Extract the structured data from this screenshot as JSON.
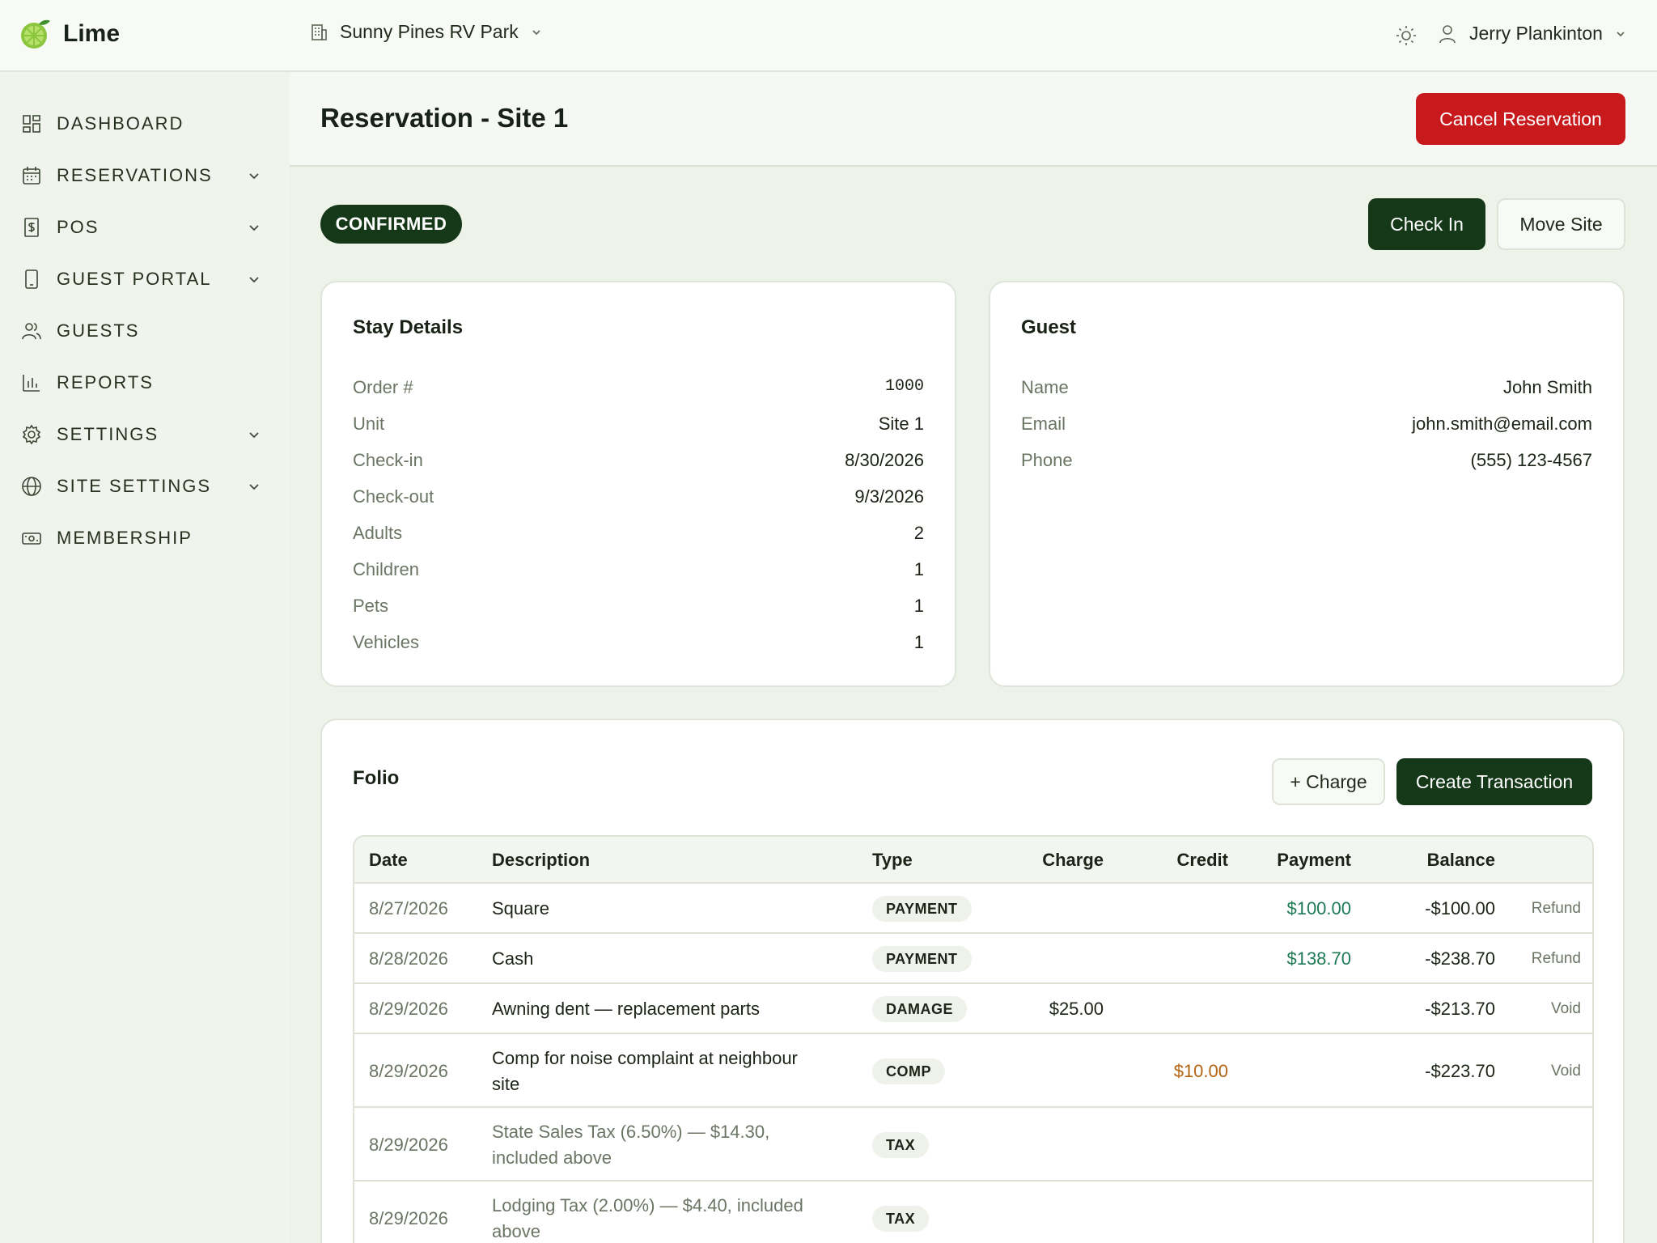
{
  "app": {
    "name": "Lime"
  },
  "topbar": {
    "park": "Sunny Pines RV Park",
    "user": "Jerry Plankinton"
  },
  "sidebar": {
    "items": [
      {
        "label": "DASHBOARD",
        "icon": "dashboard-icon",
        "expandable": false
      },
      {
        "label": "RESERVATIONS",
        "icon": "calendar-icon",
        "expandable": true
      },
      {
        "label": "POS",
        "icon": "receipt-icon",
        "expandable": true
      },
      {
        "label": "GUEST PORTAL",
        "icon": "tablet-icon",
        "expandable": true
      },
      {
        "label": "GUESTS",
        "icon": "users-icon",
        "expandable": false
      },
      {
        "label": "REPORTS",
        "icon": "bar-chart-icon",
        "expandable": false
      },
      {
        "label": "SETTINGS",
        "icon": "gear-icon",
        "expandable": true
      },
      {
        "label": "SITE SETTINGS",
        "icon": "globe-icon",
        "expandable": true
      },
      {
        "label": "MEMBERSHIP",
        "icon": "membership-card-icon",
        "expandable": false
      }
    ]
  },
  "page": {
    "title": "Reservation - Site 1",
    "cancel_label": "Cancel Reservation",
    "status": "CONFIRMED",
    "checkin_label": "Check In",
    "move_label": "Move Site"
  },
  "stay": {
    "title": "Stay Details",
    "rows": [
      {
        "k": "Order #",
        "v": "1000"
      },
      {
        "k": "Unit",
        "v": "Site 1"
      },
      {
        "k": "Check-in",
        "v": "8/30/2026"
      },
      {
        "k": "Check-out",
        "v": "9/3/2026"
      },
      {
        "k": "Adults",
        "v": "2"
      },
      {
        "k": "Children",
        "v": "1"
      },
      {
        "k": "Pets",
        "v": "1"
      },
      {
        "k": "Vehicles",
        "v": "1"
      }
    ]
  },
  "guest": {
    "title": "Guest",
    "rows": [
      {
        "k": "Name",
        "v": "John Smith"
      },
      {
        "k": "Email",
        "v": "john.smith@email.com"
      },
      {
        "k": "Phone",
        "v": "(555) 123-4567"
      }
    ]
  },
  "folio": {
    "title": "Folio",
    "charge_label": "+ Charge",
    "create_label": "Create Transaction",
    "columns": [
      "Date",
      "Description",
      "Type",
      "Charge",
      "Credit",
      "Payment",
      "Balance"
    ],
    "rows": [
      {
        "date": "8/27/2026",
        "desc1": "Square",
        "desc2": "",
        "type": "PAYMENT",
        "charge": "",
        "credit": "",
        "payment": "$100.00",
        "balance": "-$100.00",
        "action": "Refund",
        "muted": false
      },
      {
        "date": "8/28/2026",
        "desc1": "Cash",
        "desc2": "",
        "type": "PAYMENT",
        "charge": "",
        "credit": "",
        "payment": "$138.70",
        "balance": "-$238.70",
        "action": "Refund",
        "muted": false
      },
      {
        "date": "8/29/2026",
        "desc1": "Awning dent — replacement parts",
        "desc2": "",
        "type": "DAMAGE",
        "charge": "$25.00",
        "credit": "",
        "payment": "",
        "balance": "-$213.70",
        "action": "Void",
        "muted": false
      },
      {
        "date": "8/29/2026",
        "desc1": "Comp for noise complaint at neighbour",
        "desc2": "site",
        "type": "COMP",
        "charge": "",
        "credit": "$10.00",
        "payment": "",
        "balance": "-$223.70",
        "action": "Void",
        "muted": false
      },
      {
        "date": "8/29/2026",
        "desc1": "State Sales Tax (6.50%) — $14.30,",
        "desc2": "included above",
        "type": "TAX",
        "charge": "",
        "credit": "",
        "payment": "",
        "balance": "",
        "action": "",
        "muted": true
      },
      {
        "date": "8/29/2026",
        "desc1": "Lodging Tax (2.00%) — $4.40, included",
        "desc2": "above",
        "type": "TAX",
        "charge": "",
        "credit": "",
        "payment": "",
        "balance": "",
        "action": "",
        "muted": true
      }
    ]
  },
  "colors": {
    "brand": "#153818",
    "danger": "#c8191d",
    "positive": "#1e7a56",
    "credit": "#b26412"
  }
}
